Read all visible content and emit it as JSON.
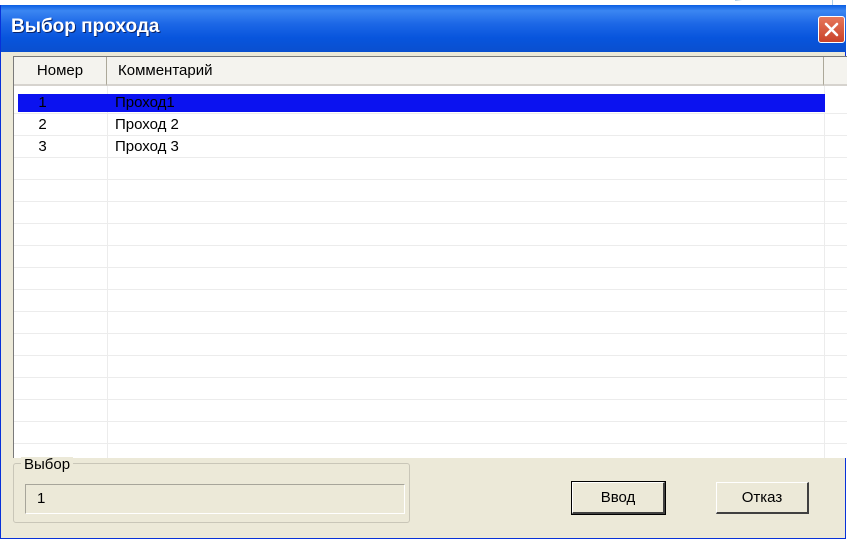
{
  "window": {
    "title": "Выбор прохода"
  },
  "list": {
    "columns": [
      "Номер",
      "Комментарий"
    ],
    "rows": [
      {
        "number": "1",
        "comment": "Проход1"
      },
      {
        "number": "2",
        "comment": "Проход 2"
      },
      {
        "number": "3",
        "comment": "Проход 3"
      }
    ],
    "selected_index": 0
  },
  "selection": {
    "group_label": "Выбор",
    "value": "1"
  },
  "buttons": {
    "ok_label": "Ввод",
    "cancel_label": "Отказ"
  },
  "colors": {
    "titlebar": "#0855dd",
    "selection": "#0b12f0",
    "close_button": "#d1502f",
    "dialog_face": "#ece9d8"
  },
  "icons": {
    "close": "close-icon"
  }
}
